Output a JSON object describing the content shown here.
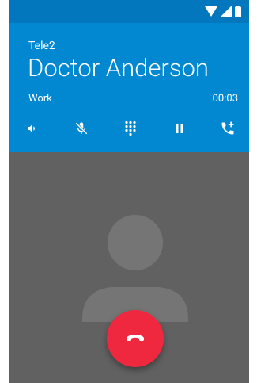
{
  "status_bar": {
    "icons": [
      "wifi-icon",
      "cellular-signal-icon",
      "battery-icon"
    ]
  },
  "call": {
    "carrier": "Tele2",
    "contact_name": "Doctor Anderson",
    "phone_label": "Work",
    "duration": "00:03"
  },
  "controls": [
    {
      "name": "speaker-icon"
    },
    {
      "name": "mute-icon"
    },
    {
      "name": "dialpad-icon"
    },
    {
      "name": "hold-icon"
    },
    {
      "name": "add-call-icon"
    }
  ],
  "colors": {
    "status_bar": "#0277bd",
    "header": "#0288d1",
    "background": "#616161",
    "avatar": "#757575",
    "end_call": "#f0283f"
  },
  "end_call": {
    "icon": "end-call-icon"
  }
}
